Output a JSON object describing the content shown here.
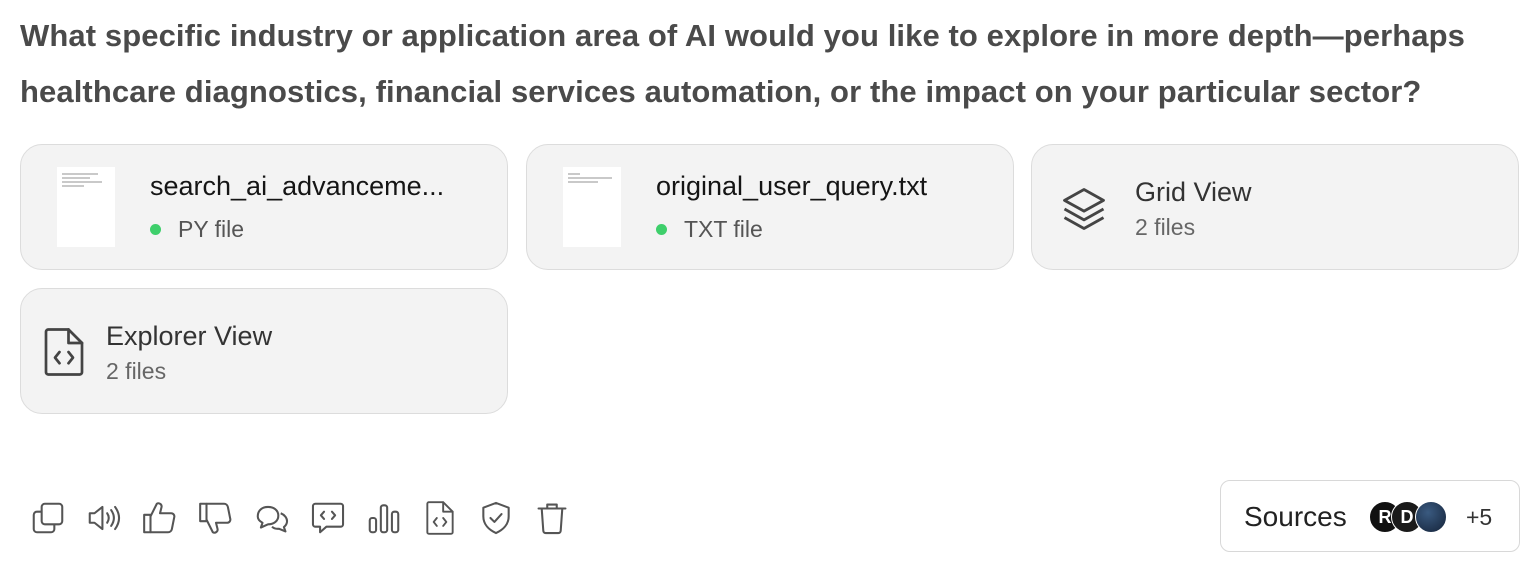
{
  "message": {
    "question": "What specific industry or application area of AI would you like to explore in more depth—perhaps healthcare diagnostics, financial services automation, or the impact on your particular sector?"
  },
  "attachments": [
    {
      "name": "search_ai_advanceme...",
      "type": "PY file",
      "status_color": "#3ecf6b"
    },
    {
      "name": "original_user_query.txt",
      "type": "TXT file",
      "status_color": "#3ecf6b"
    }
  ],
  "views": [
    {
      "title": "Grid View",
      "count": "2 files",
      "icon": "layers-icon"
    },
    {
      "title": "Explorer View",
      "count": "2 files",
      "icon": "code-file-icon"
    }
  ],
  "toolbar": {
    "actions": [
      "copy-icon",
      "read-aloud-icon",
      "thumbs-up-icon",
      "thumbs-down-icon",
      "chat-bubbles-icon",
      "code-bubble-icon",
      "bar-chart-icon",
      "code-file-icon",
      "shield-check-icon",
      "trash-icon"
    ]
  },
  "sources": {
    "label": "Sources",
    "more_count": "+5",
    "avatars": [
      {
        "letter": "R",
        "color": "#111111"
      },
      {
        "letter": "D",
        "color": "#1a1a1a"
      },
      {
        "letter": "",
        "color": "#1f3350"
      }
    ]
  }
}
